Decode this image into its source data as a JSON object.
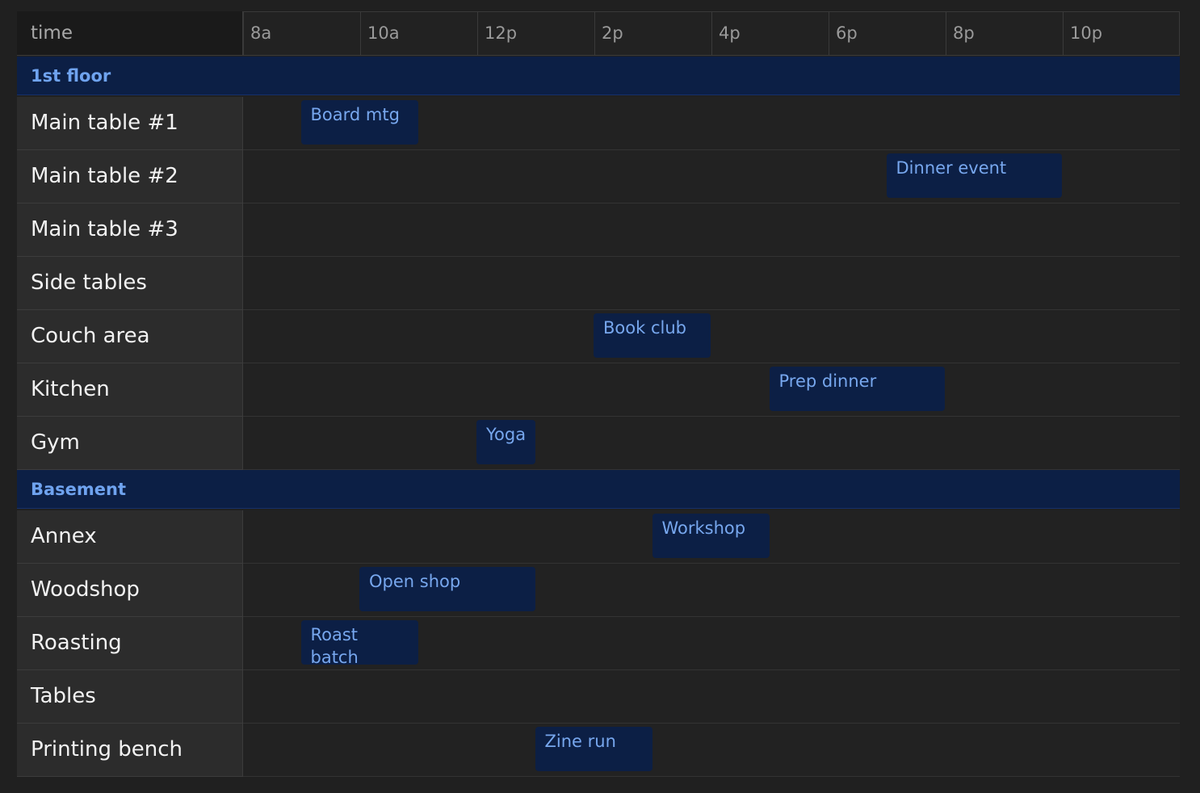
{
  "header": {
    "label": "time",
    "times": [
      "8a",
      "10a",
      "12p",
      "2p",
      "4p",
      "6p",
      "8p",
      "10p"
    ]
  },
  "rows": [
    {
      "kind": "group",
      "label": "1st floor"
    },
    {
      "kind": "resource",
      "label": "Main table #1",
      "events": [
        {
          "title": "Board mtg",
          "start": "9a",
          "end": "11a"
        }
      ]
    },
    {
      "kind": "resource",
      "label": "Main table #2",
      "events": [
        {
          "title": "Dinner event",
          "start": "7p",
          "end": "10p"
        }
      ]
    },
    {
      "kind": "resource",
      "label": "Main table #3",
      "events": []
    },
    {
      "kind": "resource",
      "label": "Side tables",
      "events": []
    },
    {
      "kind": "resource",
      "label": "Couch area",
      "events": [
        {
          "title": "Book club",
          "start": "2p",
          "end": "4p"
        }
      ]
    },
    {
      "kind": "resource",
      "label": "Kitchen",
      "events": [
        {
          "title": "Prep dinner",
          "start": "5p",
          "end": "8p"
        }
      ]
    },
    {
      "kind": "resource",
      "label": "Gym",
      "events": [
        {
          "title": "Yoga",
          "start": "12p",
          "end": "1p"
        }
      ]
    },
    {
      "kind": "group",
      "label": "Basement"
    },
    {
      "kind": "resource",
      "label": "Annex",
      "events": [
        {
          "title": "Workshop",
          "start": "3p",
          "end": "5p"
        }
      ]
    },
    {
      "kind": "resource",
      "label": "Woodshop",
      "events": [
        {
          "title": "Open shop",
          "start": "10a",
          "end": "1p"
        }
      ]
    },
    {
      "kind": "resource",
      "label": "Roasting",
      "events": [
        {
          "title": "Roast batch",
          "start": "9a",
          "end": "11a"
        }
      ]
    },
    {
      "kind": "resource",
      "label": "Tables",
      "events": []
    },
    {
      "kind": "resource",
      "label": "Printing bench",
      "events": [
        {
          "title": "Zine run",
          "start": "1p",
          "end": "3p"
        }
      ]
    }
  ],
  "colors": {
    "background": "#202020",
    "group_bg": "#0c1f45",
    "group_text": "#6fa3ef",
    "event_bg": "#0c1f45",
    "event_text": "#77a7ee"
  }
}
